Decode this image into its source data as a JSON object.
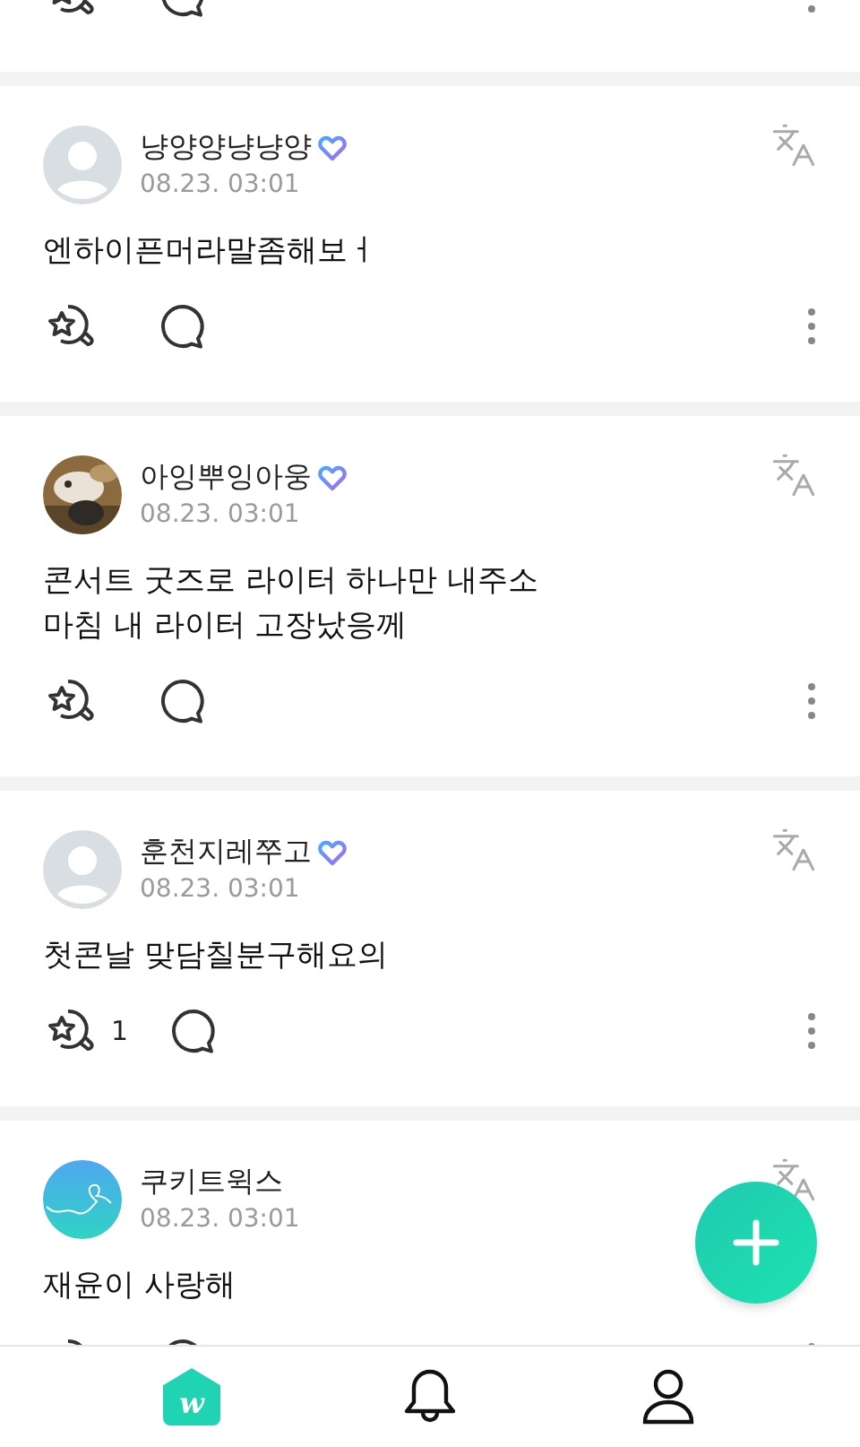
{
  "posts": [
    {
      "author": "냥양양냥냥양",
      "verified": true,
      "avatar": {
        "kind": "default"
      },
      "time": "08.23. 03:01",
      "body": [
        "엔하이픈머라말좀해보ㅓ"
      ]
    },
    {
      "author": "아잉뿌잉아웅",
      "verified": true,
      "avatar": {
        "kind": "picture"
      },
      "time": "08.23. 03:01",
      "body": [
        "콘서트 굿즈로 라이터 하나만 내주소",
        "마침 내 라이터 고장났응께"
      ]
    },
    {
      "author": "훈천지레쭈고",
      "verified": true,
      "avatar": {
        "kind": "default"
      },
      "time": "08.23. 03:01",
      "body": [
        "첫콘날 맞담칠분구해요의"
      ],
      "likes": "1"
    },
    {
      "author": "쿠키트윅스",
      "verified": false,
      "avatar": {
        "kind": "artwork"
      },
      "time": "08.23. 03:01",
      "body": [
        "재윤이 사랑해"
      ]
    }
  ],
  "nav": [
    {
      "kind": "home",
      "label": "w",
      "selected": true
    },
    {
      "kind": "bell",
      "selected": false
    },
    {
      "kind": "profile",
      "selected": false
    }
  ]
}
